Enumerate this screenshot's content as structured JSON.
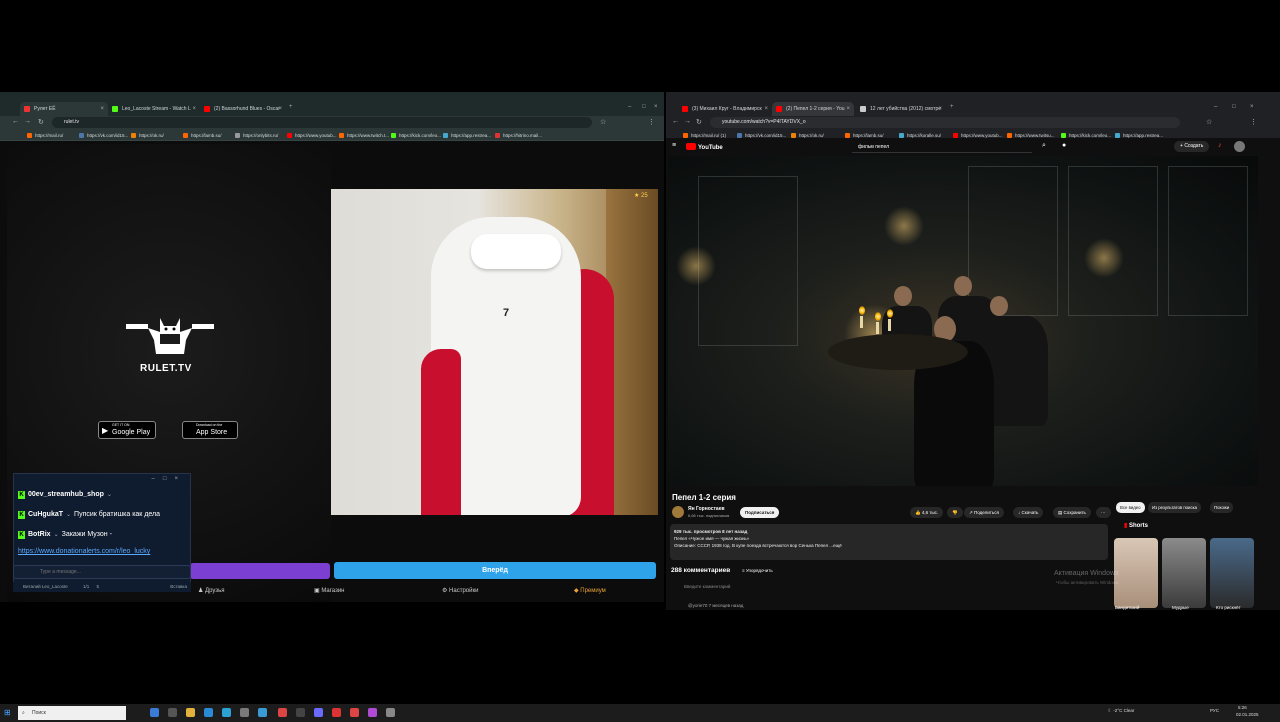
{
  "left_browser": {
    "tabs": [
      {
        "label": "Рулет ЕЁ",
        "color": "#e33"
      },
      {
        "label": "Leo_Lacoste Stream - Watch L",
        "color": "#53fc18"
      },
      {
        "label": "(2) Bassorhund Blues - Oscar",
        "color": "#f00"
      }
    ],
    "url": "rulet.tv",
    "bookmarks": [
      {
        "label": "https://mail.ru/",
        "color": "#f60"
      },
      {
        "label": "https://vk.com/id15...",
        "color": "#4a76a8"
      },
      {
        "label": "https://ok.ru/",
        "color": "#ee8208"
      },
      {
        "label": "https://lamb.su/",
        "color": "#f60"
      },
      {
        "label": "https://onlybits.ru/",
        "color": "#999"
      },
      {
        "label": "https://www.youtub...",
        "color": "#f00"
      },
      {
        "label": "https://www.twitch.t...",
        "color": "#f60"
      },
      {
        "label": "https://kick.com/leo...",
        "color": "#53fc18"
      },
      {
        "label": "https://app.restrea...",
        "color": "#4ac"
      },
      {
        "label": "https://hitrino.mail...",
        "color": "#d33"
      }
    ],
    "site": {
      "logo_text": "RULET.TV",
      "google_play_small": "GET IT ON",
      "google_play": "Google Play",
      "app_store_small": "Download on the",
      "app_store": "App Store",
      "next_button": "Вперёд",
      "nav_friends": "Друзья",
      "nav_shop": "Магазин",
      "nav_settings": "Настройки",
      "nav_premium": "Премиум",
      "video_counter": "25"
    },
    "chat": {
      "messages": [
        {
          "user": "00ev_streamhub_shop",
          "text": ""
        },
        {
          "user": "CuHgukaT",
          "text": "Пупсик братишка как дела"
        },
        {
          "user": "BotRix",
          "text": "Закажи Музон -"
        }
      ],
      "link": "https://www.donationalerts.com/r/leo_lucky",
      "input_placeholder": "Type a message...",
      "footer_user": "Виталий Leo_Lacoste",
      "footer_count": "1/1",
      "footer_extra": "5",
      "footer_right": "Вставка"
    }
  },
  "right_browser": {
    "tabs": [
      {
        "label": "(3) Михаил Круг - Владимирск",
        "color": "#f00"
      },
      {
        "label": "(2) Пепел 1-2 серия - You",
        "color": "#f00"
      },
      {
        "label": "12 лет убийства (2012) смотре",
        "color": "#ccc"
      }
    ],
    "url": "youtube.com/watch?v=P4ITAYDVX_o",
    "bookmarks": [
      {
        "label": "https://mail.ru/ (1)",
        "color": "#f60"
      },
      {
        "label": "https://vk.com/id15...",
        "color": "#4a76a8"
      },
      {
        "label": "https://ok.ru/",
        "color": "#ee8208"
      },
      {
        "label": "https://lamb.su/",
        "color": "#f60"
      },
      {
        "label": "https://koralle.su/",
        "color": "#4ac"
      },
      {
        "label": "https://www.youtub...",
        "color": "#f00"
      },
      {
        "label": "https://www.twitsu...",
        "color": "#f60"
      },
      {
        "label": "https://kick.com/leo...",
        "color": "#53fc18"
      },
      {
        "label": "https://app.restrea...",
        "color": "#4ac"
      }
    ],
    "youtube": {
      "logo": "YouTube",
      "search_value": "фильм пепел",
      "create_label": "Создать",
      "video_title": "Пепел 1-2 серия",
      "channel_name": "Ян Горностаев",
      "channel_subs": "6,66 тыс. подписчиков",
      "subscribe": "Подписаться",
      "likes": "4,6 тыс.",
      "share": "Поделиться",
      "download": "Скачать",
      "save": "Сохранить",
      "desc_line1": "929 тыс. просмотров  8 лет назад",
      "desc_line2": "Пепел «Чужое имя — чужая жизнь»",
      "desc_line3": "Описание: СССР, 1938 год. В купе поезда встречаются вор Сенька Пепел  ...ещё",
      "comments_count": "288 комментариев",
      "sort": "Упорядочить",
      "comment_input": "Введите комментарий",
      "first_comment": "@yorie70  7 месяцев назад",
      "chips": [
        "Все видео",
        "Из результатов поиска",
        "Похожи"
      ],
      "shorts_header": "Shorts",
      "shorts": [
        {
          "label": "Бандитский"
        },
        {
          "label": "Мудрые"
        },
        {
          "label": "Кто рискнёт"
        }
      ],
      "watermark": "Активация Windows",
      "watermark_sub": "Чтобы активировать Windows,"
    }
  },
  "taskbar": {
    "search": "Поиск",
    "weather": "-2°C  Clear",
    "lang": "РУС",
    "time": "5:26",
    "date": "02.01.2025"
  }
}
